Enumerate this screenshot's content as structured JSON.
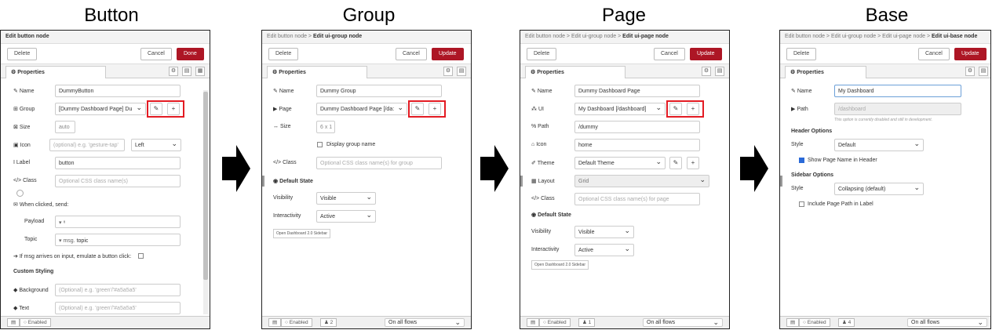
{
  "titles": [
    "Button",
    "Group",
    "Page",
    "Base"
  ],
  "common": {
    "delete": "Delete",
    "cancel": "Cancel",
    "update": "Update",
    "done": "Done",
    "properties": "Properties",
    "enabled": "Enabled",
    "on_all_flows": "On all flows",
    "open_sidebar": "Open Dashboard 2.0 Sidebar",
    "default_state": "Default State",
    "visibility": "Visibility",
    "visible": "Visible",
    "interactivity": "Interactivity",
    "active": "Active",
    "class": "Class"
  },
  "button": {
    "header": "Edit button node",
    "name_label": "Name",
    "name_value": "DummyButton",
    "group_label": "Group",
    "group_value": "[Dummy Dashboard Page] Du",
    "size_label": "Size",
    "size_value": "auto",
    "icon_label": "Icon",
    "icon_placeholder": "(optional) e.g. 'gesture-tap'",
    "icon_pos": "Left",
    "label_label": "Label",
    "label_value": "button",
    "class_placeholder": "Optional CSS class name(s)",
    "when_clicked": "When clicked, send:",
    "payload_label": "Payload",
    "topic_label": "Topic",
    "topic_prefix": "msg.",
    "topic_value": "topic",
    "emulate": "If msg arrives on input, emulate a button click:",
    "custom_styling": "Custom Styling",
    "background_label": "Background",
    "background_placeholder": "(Optional) e.g. 'green'/'#a5a5a5'",
    "text_label": "Text",
    "text_placeholder": "(Optional) e.g. 'green'/'#a5a5a5'"
  },
  "group": {
    "header_prefix": "Edit button node > ",
    "header_last": "Edit ui-group node",
    "name_value": "Dummy Group",
    "page_label": "Page",
    "page_value": "Dummy Dashboard Page [/da:",
    "size_label": "Size",
    "size_value": "6 x 1",
    "display_name": "Display group name",
    "class_placeholder": "Optional CSS class name(s) for group",
    "users": "2"
  },
  "page": {
    "header_prefix": "Edit button node > Edit ui-group node > ",
    "header_last": "Edit ui-page node",
    "name_value": "Dummy Dashboard Page",
    "ui_label": "UI",
    "ui_value": "My Dashboard [/dashboard]",
    "path_label": "Path",
    "path_value": "/dummy",
    "icon_label": "Icon",
    "icon_value": "home",
    "theme_label": "Theme",
    "theme_value": "Default Theme",
    "layout_label": "Layout",
    "layout_value": "Grid",
    "class_placeholder": "Optional CSS class name(s) for page",
    "users": "1"
  },
  "base": {
    "header_prefix": "Edit button node > Edit ui-group node > Edit ui-page node > ",
    "header_last": "Edit ui-base node",
    "name_value": "My Dashboard",
    "path_label": "Path",
    "path_placeholder": "/dashboard",
    "path_note": "This option is currently disabled and still in development.",
    "header_options": "Header Options",
    "style_label": "Style",
    "style_value": "Default",
    "show_page_name": "Show Page Name in Header",
    "sidebar_options": "Sidebar Options",
    "sidebar_style": "Collapsing (default)",
    "include_path": "Include Page Path in Label",
    "users": "4"
  }
}
